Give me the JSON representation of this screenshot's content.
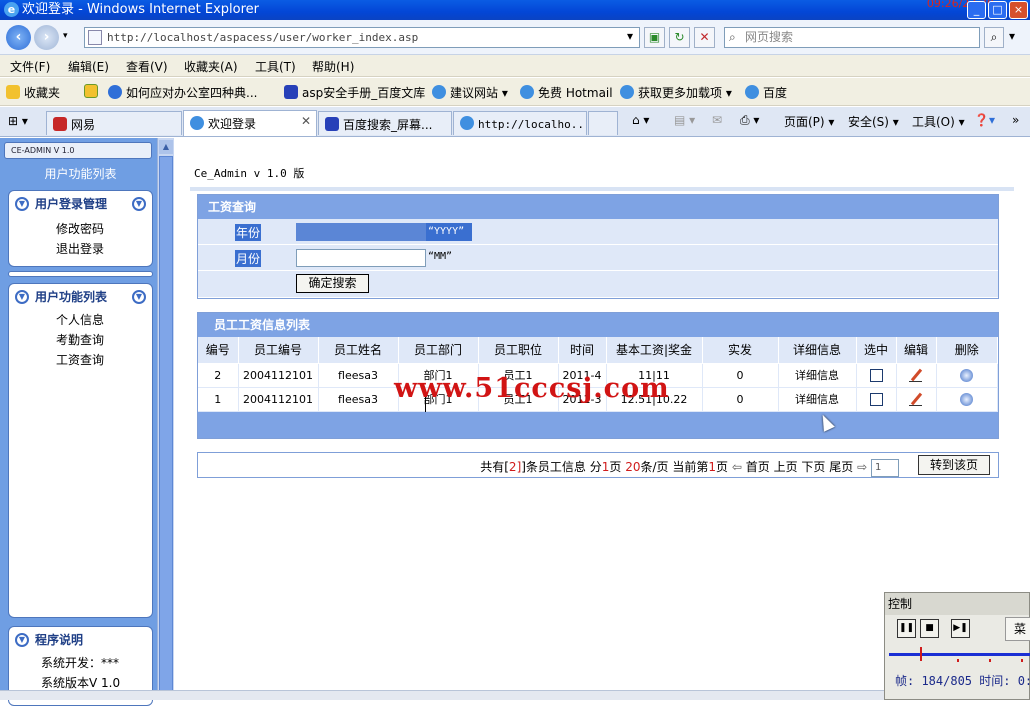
{
  "window": {
    "title": "欢迎登录 - Windows Internet Explorer",
    "clock": "09:26/23:20"
  },
  "address": {
    "url": "http://localhost/aspacess/user/worker_index.asp",
    "search_placeholder": "网页搜索"
  },
  "menu": [
    "文件(F)",
    "编辑(E)",
    "查看(V)",
    "收藏夹(A)",
    "工具(T)",
    "帮助(H)"
  ],
  "favorites": {
    "label": "收藏夹",
    "items": [
      "如何应对办公室四种典...",
      "asp安全手册_百度文库",
      "建议网站 ▾",
      "免费 Hotmail",
      "获取更多加载项 ▾",
      "百度"
    ]
  },
  "tabs": [
    "网易",
    "欢迎登录",
    "百度搜索_屏幕...",
    "http://localho..."
  ],
  "commands": [
    "页面(P) ▾",
    "安全(S) ▾",
    "工具(O) ▾"
  ],
  "sidebar": {
    "logo": "CE-ADMIN V 1.0",
    "heading": "用户功能列表",
    "groups": [
      {
        "title": "用户登录管理",
        "items": [
          "修改密码",
          "退出登录"
        ]
      },
      {
        "title": "用户功能列表",
        "items": [
          "个人信息",
          "考勤查询",
          "工资查询"
        ]
      },
      {
        "title": "程序说明",
        "items": [
          "系统开发：***",
          "系统版本V 1.0"
        ]
      }
    ]
  },
  "main": {
    "title": "Ce_Admin v 1.0 版",
    "query": {
      "header": "工资查询",
      "year_label": "年份",
      "year_hint": "“YYYY”",
      "month_label": "月份",
      "month_hint": "“MM”",
      "submit": "确定搜索"
    },
    "list": {
      "header": "员工工资信息列表",
      "columns": [
        "编号",
        "员工编号",
        "员工姓名",
        "员工部门",
        "员工职位",
        "时间",
        "基本工资|奖金",
        "实发",
        "详细信息",
        "选中",
        "编辑",
        "删除"
      ],
      "rows": [
        {
          "id": "2",
          "emp_no": "2004112101",
          "name": "fleesa3",
          "dept": "部门1",
          "position": "员工1",
          "time": "2011-4",
          "salary": "11|11",
          "actual": "0",
          "detail": "详细信息"
        },
        {
          "id": "1",
          "emp_no": "2004112101",
          "name": "fleesa3",
          "dept": "部门1",
          "position": "员工1",
          "time": "2011-3",
          "salary": "12.51|10.22",
          "actual": "0",
          "detail": "详细信息"
        }
      ]
    },
    "pager": {
      "t1": "共有[",
      "total": "2",
      "t2": "]条员工信息 分",
      "pages": "1",
      "t3": "页 ",
      "per": "20",
      "t4": "条/页 当前第",
      "current": "1",
      "t5": "页",
      "first": "首页",
      "prev": "上页",
      "next": "下页",
      "last": "尾页",
      "input_value": "1",
      "go": "转到该页"
    }
  },
  "watermark": "www.51cccsj.com",
  "control": {
    "caption": "控制",
    "menu": "菜",
    "status": "帧: 184/805 时间: 0:"
  }
}
